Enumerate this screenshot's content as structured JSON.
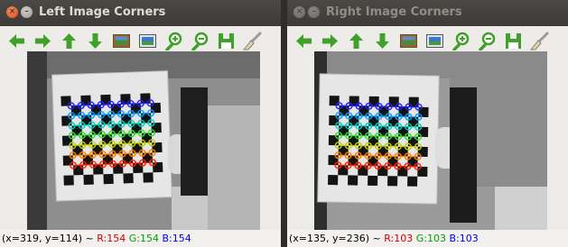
{
  "left": {
    "title": "Left Image Corners",
    "status": {
      "coords": "(x=319, y=114) ~ ",
      "r": "R:154",
      "g": "G:154",
      "b": "B:154"
    }
  },
  "right": {
    "title": "Right Image Corners",
    "status": {
      "coords": "(x=135, y=236) ~ ",
      "r": "R:103",
      "g": "G:103",
      "b": "B:103"
    }
  },
  "toolbar": [
    {
      "icon": "arrow-left-icon",
      "name": "pan-left"
    },
    {
      "icon": "arrow-right-icon",
      "name": "pan-right"
    },
    {
      "icon": "arrow-up-icon",
      "name": "pan-up"
    },
    {
      "icon": "arrow-down-icon",
      "name": "pan-down"
    },
    {
      "icon": "zoom-fit-icon",
      "name": "zoom-fit"
    },
    {
      "icon": "zoom-original-icon",
      "name": "zoom-original"
    },
    {
      "icon": "zoom-in-icon",
      "name": "zoom-in"
    },
    {
      "icon": "zoom-out-icon",
      "name": "zoom-out"
    },
    {
      "icon": "save-icon",
      "name": "save"
    },
    {
      "icon": "brush-icon",
      "name": "properties"
    }
  ],
  "colors": {
    "arrow": "#3fa02a",
    "corner_rows": [
      "#2020ff",
      "#00a0ff",
      "#00d0c0",
      "#30e030",
      "#c0d000",
      "#ff8000",
      "#ff2000"
    ]
  }
}
